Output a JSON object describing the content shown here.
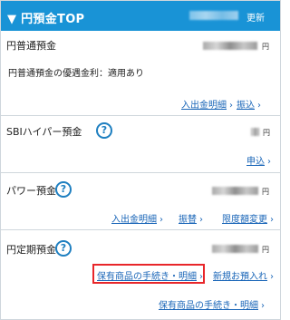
{
  "header": {
    "title": "▼ 円預金TOP",
    "refresh_label": "更新"
  },
  "futsu": {
    "title": "円普通預金",
    "currency": "円",
    "preferential_rate_note": "円普通預金の優遇金利：適用あり",
    "links": {
      "statement": "入出金明細",
      "transfer": "振込"
    }
  },
  "hybrid": {
    "title": "SBIハイパー預金",
    "currency": "円",
    "links": {
      "deposit": "申込"
    }
  },
  "power": {
    "title": "パワー預金",
    "currency": "円",
    "links": {
      "statement": "入出金明細",
      "transfer": "振替",
      "limit_change": "限度額変更"
    }
  },
  "teiki": {
    "title": "円定期預金",
    "currency": "円",
    "links": {
      "holdings_procedure": "保有商品の手続き・明細",
      "new_deposit": "新規お預入れ",
      "holdings_procedure_footer": "保有商品の手続き・明細"
    }
  },
  "icons": {
    "help": "?",
    "chevron": "›"
  }
}
